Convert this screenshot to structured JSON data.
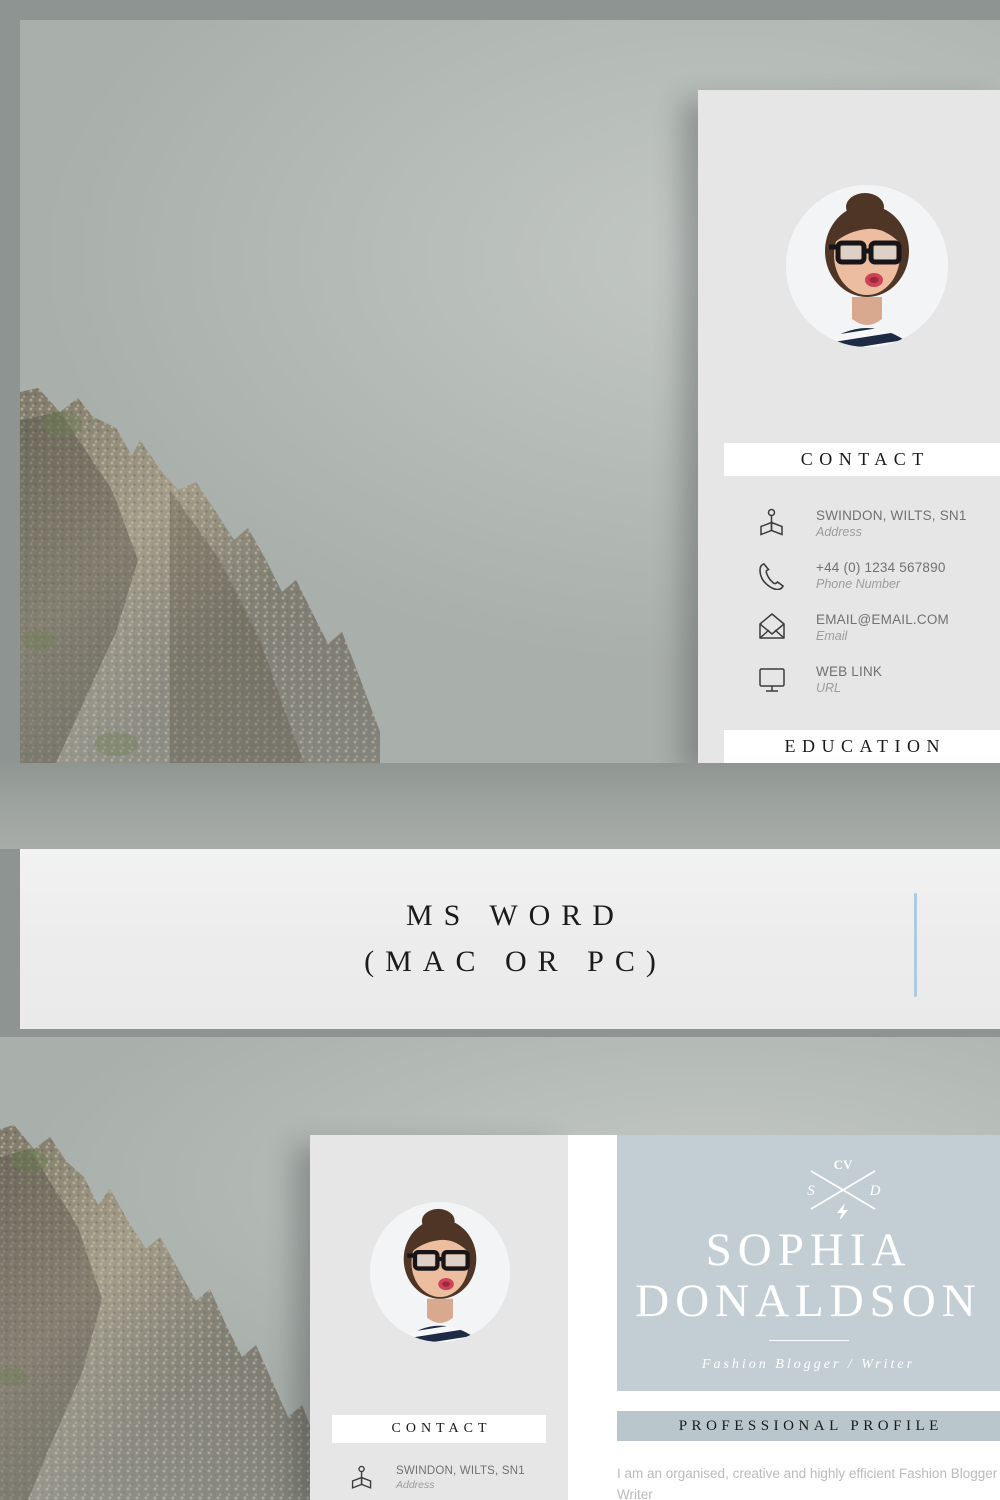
{
  "banner": {
    "line1": "MS WORD",
    "line2": "(MAC OR PC)",
    "accent_color": "#aecade"
  },
  "colors": {
    "panel_grey": "#e6e6e6",
    "panel_blue": "#c3ced4",
    "header_blue": "#b9c6cc",
    "backdrop_grey": "#8e9491",
    "text_dark": "#1a1a1a",
    "text_value": "#6f7173",
    "text_label": "#9a9c9e"
  },
  "top_card": {
    "avatar": "portrait-photo",
    "contact": {
      "heading": "CONTACT",
      "rows": [
        {
          "icon": "map-pin-icon",
          "value": "SWINDON, WILTS, SN1",
          "label": "Address"
        },
        {
          "icon": "phone-icon",
          "value": "+44 (0) 1234 567890",
          "label": "Phone Number"
        },
        {
          "icon": "envelope-icon",
          "value": "EMAIL@EMAIL.COM",
          "label": "Email"
        },
        {
          "icon": "monitor-icon",
          "value": "WEB LINK",
          "label": "URL"
        }
      ]
    },
    "education_heading": "EDUCATION"
  },
  "bottom_card": {
    "avatar": "portrait-photo",
    "contact": {
      "heading": "CONTACT",
      "rows": [
        {
          "icon": "map-pin-icon",
          "value": "SWINDON, WILTS, SN1",
          "label": "Address"
        }
      ]
    },
    "emblem": {
      "top": "CV",
      "left": "S",
      "right": "D",
      "bottom": "lightning-bolt-icon"
    },
    "first_name": "SOPHIA",
    "last_name": "DONALDSON",
    "subtitle": "Fashion Blogger / Writer",
    "profile_heading": "PROFESSIONAL PROFILE",
    "profile_body": "I am an organised, creative and highly efficient Fashion Blogger / Writer"
  }
}
